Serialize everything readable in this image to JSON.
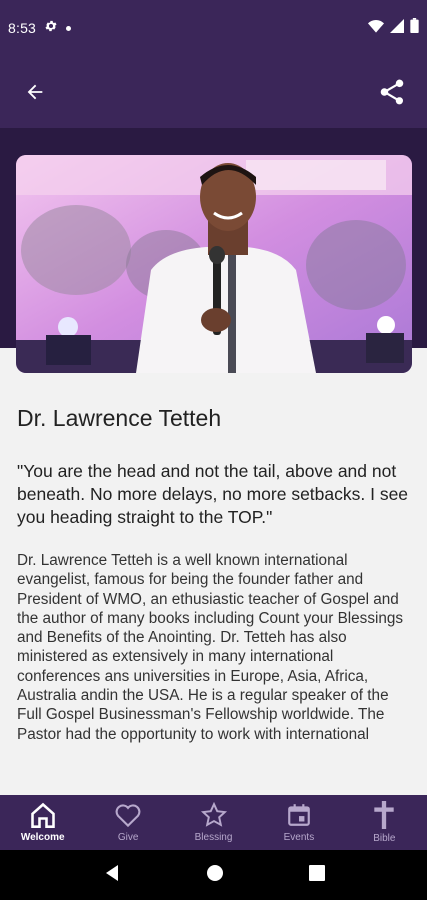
{
  "status": {
    "time": "8:53"
  },
  "profile": {
    "name": "Dr. Lawrence Tetteh",
    "quote": "\"You are the head and not the tail, above and not beneath. No more delays, no more setbacks. I see you heading straight to the TOP.\"",
    "bio": "Dr. Lawrence Tetteh is a well known international evangelist, famous for being the founder father and President of WMO, an ethusiastic teacher of Gospel and the author of many books including Count your Blessings and Benefits of the Anointing. Dr. Tetteh has also ministered as extensively in many international conferences ans universities in Europe, Asia, Africa, Australia andin the USA. He is a regular speaker of the Full Gospel Businessman's Fellowship worldwide. The Pastor had the opportunity to work with international"
  },
  "nav": {
    "items": [
      {
        "label": "Welcome",
        "icon": "home-icon",
        "active": true
      },
      {
        "label": "Give",
        "icon": "heart-icon",
        "active": false
      },
      {
        "label": "Blessing",
        "icon": "star-icon",
        "active": false
      },
      {
        "label": "Events",
        "icon": "calendar-icon",
        "active": false
      },
      {
        "label": "Bible",
        "icon": "cross-icon",
        "active": false
      }
    ]
  },
  "colors": {
    "primary": "#3b2659",
    "nav_inactive": "#b7a8cc"
  }
}
